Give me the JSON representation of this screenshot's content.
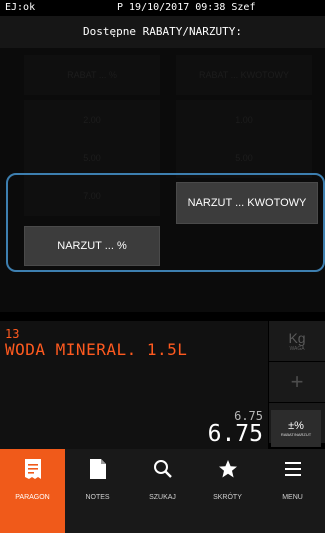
{
  "status": {
    "left": "EJ:ok",
    "right": "P 19/10/2017 09:38 Szef"
  },
  "title": "Dostępne RABATY/NARZUTY:",
  "background_buttons": [
    "RABAT ... %",
    "RABAT ... KWOTOWY",
    "2.00",
    "1.00",
    "5.00",
    "5.00",
    "7.00"
  ],
  "popup": {
    "narzut_kwotowy": "NARZUT ... KWOTOWY",
    "narzut_procent": "NARZUT ... %"
  },
  "receipt": {
    "item_number": "13",
    "item_name": "WODA MINERAL. 1.5L",
    "unit_price": "6.75",
    "total": "6.75"
  },
  "side_keys": {
    "kg_big": "Kg",
    "kg_small": "WAGA",
    "plus": "+",
    "minus": "−",
    "rabat_big": "±%",
    "rabat_small": "RABAT/NARZUT"
  },
  "nav": [
    "PARAGON",
    "NOTES",
    "SZUKAJ",
    "SKRÓTY",
    "MENU"
  ],
  "colors": {
    "accent": "#f05a1a",
    "item_text": "#ff5a1f",
    "popup_border": "#3d7fb0"
  }
}
